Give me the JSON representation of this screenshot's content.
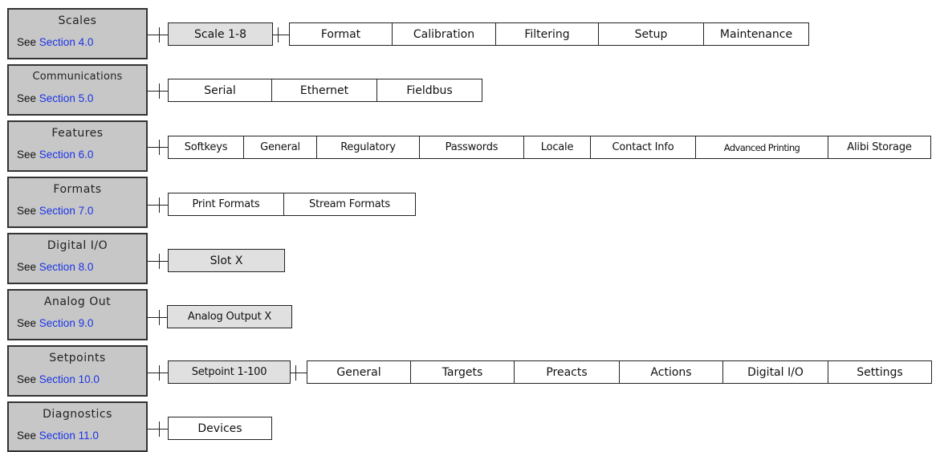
{
  "see_prefix": "See",
  "groups": [
    {
      "title": "Scales",
      "section": "Section 4.0",
      "items": [
        "Scale 1-8",
        "Format",
        "Calibration",
        "Filtering",
        "Setup",
        "Maintenance"
      ]
    },
    {
      "title": "Communications",
      "section": "Section 5.0",
      "items": [
        "Serial",
        "Ethernet",
        "Fieldbus"
      ]
    },
    {
      "title": "Features",
      "section": "Section 6.0",
      "items": [
        "Softkeys",
        "General",
        "Regulatory",
        "Passwords",
        "Locale",
        "Contact Info",
        "Advanced Printing",
        "Alibi Storage"
      ]
    },
    {
      "title": "Formats",
      "section": "Section 7.0",
      "items": [
        "Print Formats",
        "Stream Formats"
      ]
    },
    {
      "title": "Digital I/O",
      "section": "Section 8.0",
      "items": [
        "Slot X"
      ]
    },
    {
      "title": "Analog Out",
      "section": "Section 9.0",
      "items": [
        "Analog Output X"
      ]
    },
    {
      "title": "Setpoints",
      "section": "Section 10.0",
      "items": [
        "Setpoint 1-100",
        "General",
        "Targets",
        "Preacts",
        "Actions",
        "Digital I/O",
        "Settings"
      ]
    },
    {
      "title": "Diagnostics",
      "section": "Section 11.0",
      "items": [
        "Devices"
      ]
    }
  ]
}
